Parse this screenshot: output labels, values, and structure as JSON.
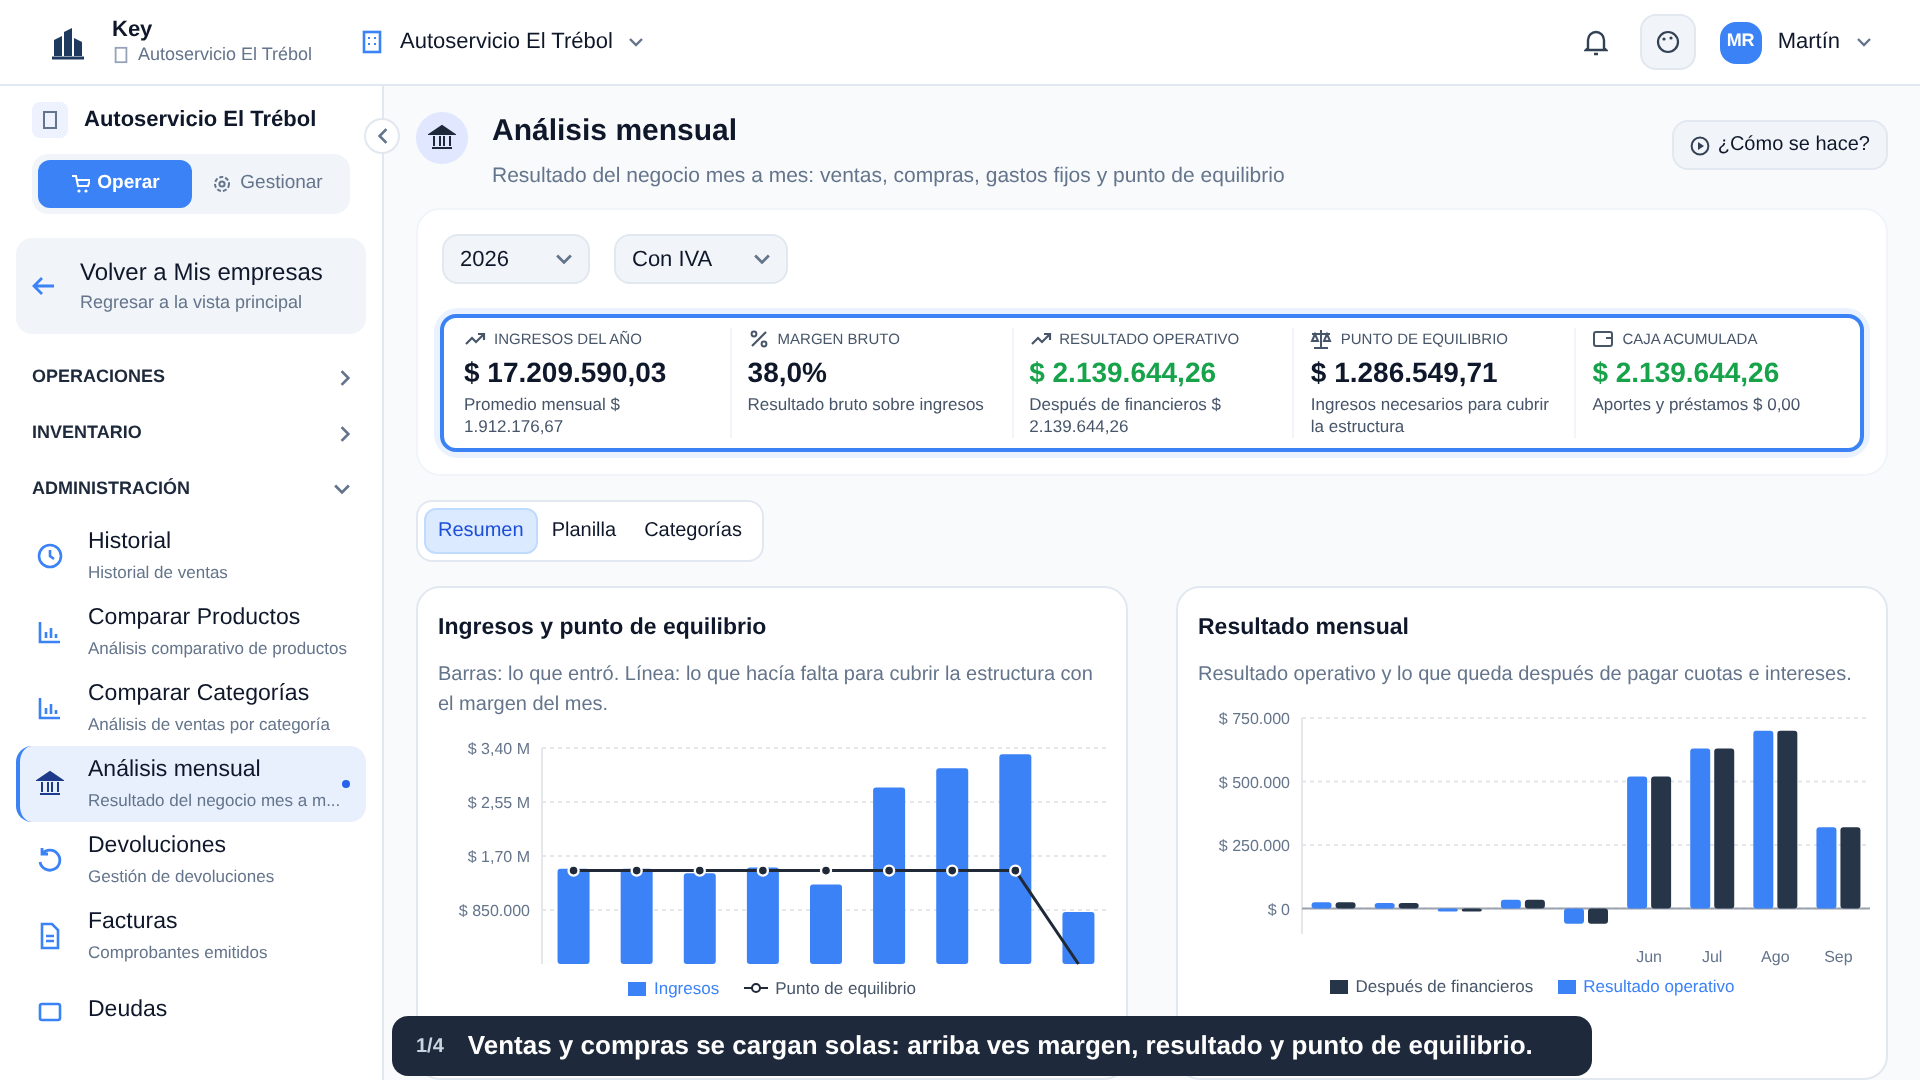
{
  "app": {
    "name": "Key",
    "subtitle": "Autoservicio El Trébol",
    "business_selector": "Autoservicio El Trébol"
  },
  "header": {
    "user_initials": "MR",
    "user_name": "Martín"
  },
  "sidebar": {
    "business": "Autoservicio El Trébol",
    "modes": [
      {
        "label": "Operar",
        "selected": true
      },
      {
        "label": "Gestionar",
        "selected": false
      }
    ],
    "back": {
      "title": "Volver a Mis empresas",
      "subtitle": "Regresar a la vista principal"
    },
    "sections": [
      {
        "label": "OPERACIONES",
        "expanded": false
      },
      {
        "label": "INVENTARIO",
        "expanded": false
      },
      {
        "label": "ADMINISTRACIÓN",
        "expanded": true,
        "items": [
          {
            "title": "Historial",
            "subtitle": "Historial de ventas",
            "selected": false
          },
          {
            "title": "Comparar Productos",
            "subtitle": "Análisis comparativo de productos",
            "selected": false
          },
          {
            "title": "Comparar Categorías",
            "subtitle": "Análisis de ventas por categoría",
            "selected": false
          },
          {
            "title": "Análisis mensual",
            "subtitle": "Resultado del negocio mes a m...",
            "selected": true
          },
          {
            "title": "Devoluciones",
            "subtitle": "Gestión de devoluciones",
            "selected": false
          },
          {
            "title": "Facturas",
            "subtitle": "Comprobantes emitidos",
            "selected": false
          },
          {
            "title": "Deudas",
            "selected": false
          }
        ]
      }
    ]
  },
  "page": {
    "title": "Análisis mensual",
    "subtitle": "Resultado del negocio mes a mes: ventas, compras, gastos fijos y punto de equilibrio",
    "help_button": "¿Cómo se hace?"
  },
  "filters": [
    {
      "value": "2026"
    },
    {
      "value": "Con IVA"
    }
  ],
  "kpis": [
    {
      "label": "INGRESOS DEL AÑO",
      "value": "$ 17.209.590,03",
      "note": "Promedio mensual $ 1.912.176,67",
      "positive": false
    },
    {
      "label": "MARGEN BRUTO",
      "value": "38,0%",
      "note": "Resultado bruto sobre ingresos",
      "positive": false
    },
    {
      "label": "RESULTADO OPERATIVO",
      "value": "$ 2.139.644,26",
      "note": "Después de financieros $ 2.139.644,26",
      "positive": true
    },
    {
      "label": "PUNTO DE EQUILIBRIO",
      "value": "$ 1.286.549,71",
      "note": "Ingresos necesarios para cubrir la estructura",
      "positive": false
    },
    {
      "label": "CAJA ACUMULADA",
      "value": "$ 2.139.644,26",
      "note": "Aportes y préstamos $ 0,00",
      "positive": true
    }
  ],
  "tabs": [
    {
      "label": "Resumen",
      "selected": true
    },
    {
      "label": "Planilla",
      "selected": false
    },
    {
      "label": "Categorías",
      "selected": false
    }
  ],
  "charts": [
    {
      "title": "Ingresos y punto de equilibrio",
      "description": "Barras: lo que entró. Línea: lo que hacía falta para cubrir la estructura con el margen del mes.",
      "chart_data": {
        "type": "bar",
        "grid": true,
        "ylim": [
          0,
          3400000
        ],
        "yticks": [
          {
            "value": 850000,
            "label": "$ 850.000"
          },
          {
            "value": 1700000,
            "label": "$ 1,70 M"
          },
          {
            "value": 2550000,
            "label": "$ 2,55 M"
          },
          {
            "value": 3400000,
            "label": "$ 3,40 M"
          }
        ],
        "series": [
          {
            "name": "Ingresos",
            "type": "bar",
            "color": "#3b82f6",
            "values": [
              1500000,
              1500000,
              1430000,
              1520000,
              1250000,
              2780000,
              3080000,
              3300000,
              820000
            ]
          },
          {
            "name": "Punto de equilibrio",
            "type": "line",
            "marker": true,
            "color": "#1f2937",
            "values": [
              1470000,
              1470000,
              1470000,
              1470000,
              1470000,
              1470000,
              1470000,
              1470000,
              0
            ]
          }
        ]
      }
    },
    {
      "title": "Resultado mensual",
      "description": "Resultado operativo y lo que queda después de pagar cuotas e intereses.",
      "chart_data": {
        "type": "bar",
        "grid": true,
        "categories": [
          null,
          null,
          null,
          null,
          null,
          "Jun",
          "Jul",
          "Ago",
          "Sep"
        ],
        "ylim": [
          -100000,
          750000
        ],
        "yticks": [
          {
            "value": 0,
            "label": "$ 0"
          },
          {
            "value": 250000,
            "label": "$ 250.000"
          },
          {
            "value": 500000,
            "label": "$ 500.000"
          },
          {
            "value": 750000,
            "label": "$ 750.000"
          }
        ],
        "series": [
          {
            "name": "Resultado operativo",
            "type": "bar",
            "color": "#3b82f6",
            "values": [
              25000,
              22000,
              -10000,
              35000,
              -60000,
              520000,
              630000,
              700000,
              320000
            ]
          },
          {
            "name": "Después de financieros",
            "type": "bar",
            "color": "#273548",
            "values": [
              25000,
              22000,
              -10000,
              35000,
              -60000,
              520000,
              630000,
              700000,
              320000
            ]
          }
        ]
      }
    }
  ],
  "tour": {
    "step": "1/4",
    "message": "Ventas y compras se cargan solas: arriba ves margen, resultado y punto de equilibrio."
  }
}
